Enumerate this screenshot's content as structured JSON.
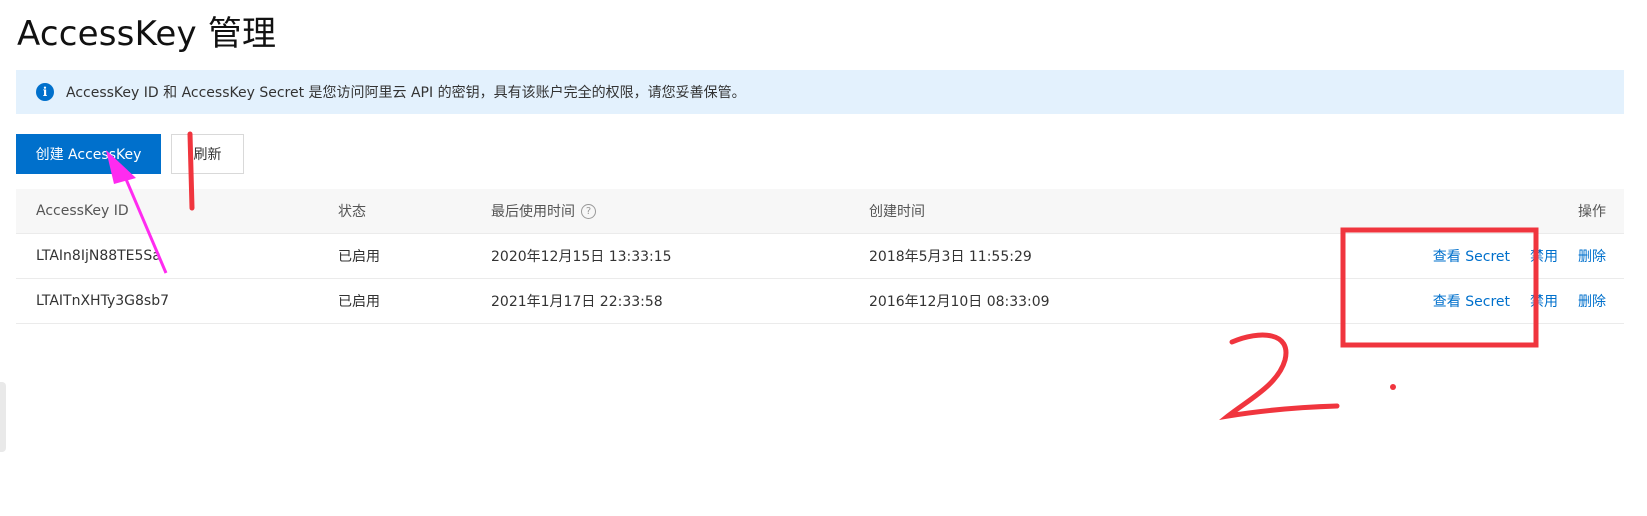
{
  "page": {
    "title": "AccessKey 管理"
  },
  "notice": {
    "icon": "info-icon",
    "text": "AccessKey ID 和 AccessKey Secret 是您访问阿里云 API 的密钥，具有该账户完全的权限，请您妥善保管。"
  },
  "toolbar": {
    "create_label": "创建 AccessKey",
    "refresh_label": "刷新"
  },
  "table": {
    "headers": {
      "id": "AccessKey ID",
      "status": "状态",
      "last_used": "最后使用时间",
      "created": "创建时间",
      "actions": "操作"
    },
    "help_icon": "?",
    "rows": [
      {
        "id": "LTAIn8IjN88TE5Sa",
        "status": "已启用",
        "last_used": "2020年12月15日 13:33:15",
        "created": "2018年5月3日 11:55:29",
        "view_secret": "查看 Secret",
        "disable": "禁用",
        "delete": "删除"
      },
      {
        "id": "LTAITnXHTy3G8sb7",
        "status": "已启用",
        "last_used": "2021年1月17日 22:33:58",
        "created": "2016年12月10日 08:33:09",
        "view_secret": "查看 Secret",
        "disable": "禁用",
        "delete": "删除"
      }
    ]
  },
  "annotations": {
    "colors": {
      "red": "#f0353e",
      "magenta": "#ff2bf0"
    },
    "marks": [
      "1",
      "2"
    ]
  }
}
